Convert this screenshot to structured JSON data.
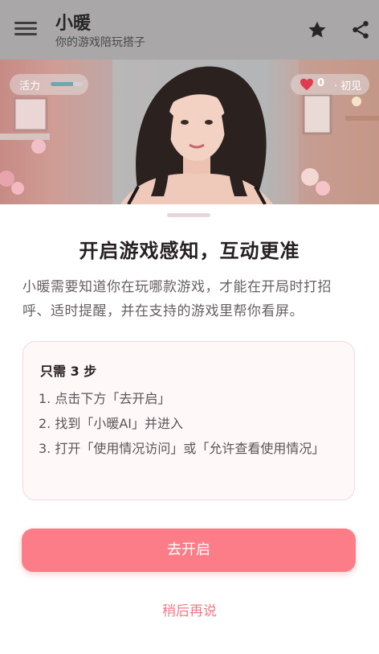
{
  "header": {
    "title": "小暖",
    "subtitle": "你的游戏陪玩搭子",
    "menu_icon": "hamburger-menu-icon",
    "star_icon": "star-icon",
    "share_icon": "share-icon"
  },
  "status": {
    "energy_label": "活力",
    "energy_level": 0.7,
    "affinity_count": "0",
    "affinity_level": "初见",
    "heart_color": "#e03c4f"
  },
  "sheet": {
    "title": "开启游戏感知，互动更准",
    "description": "小暖需要知道你在玩哪款游戏，才能在开局时打招呼、适时提醒，并在支持的游戏里帮你看屏。",
    "steps_heading": "只需 3 步",
    "steps": [
      "1. 点击下方「去开启」",
      "2. 找到「小暖AI」并进入",
      "3. 打开「使用情况访问」或「允许查看使用情况」"
    ],
    "primary_button": "去开启",
    "secondary_button": "稍后再说"
  },
  "colors": {
    "accent": "#fc7d88",
    "link": "#f47987",
    "card_border": "#f2d9de"
  }
}
